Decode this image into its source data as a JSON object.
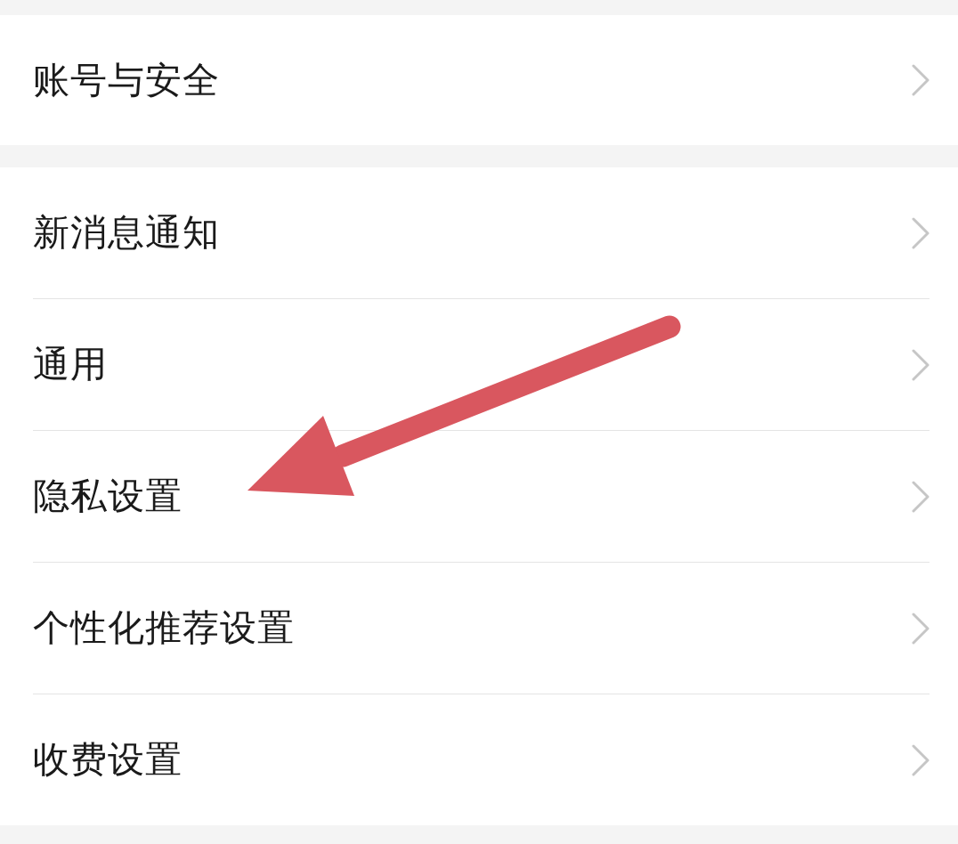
{
  "groups": [
    {
      "items": [
        {
          "label": "账号与安全"
        }
      ]
    },
    {
      "items": [
        {
          "label": "新消息通知"
        },
        {
          "label": "通用"
        },
        {
          "label": "隐私设置"
        },
        {
          "label": "个性化推荐设置"
        },
        {
          "label": "收费设置"
        }
      ]
    }
  ]
}
